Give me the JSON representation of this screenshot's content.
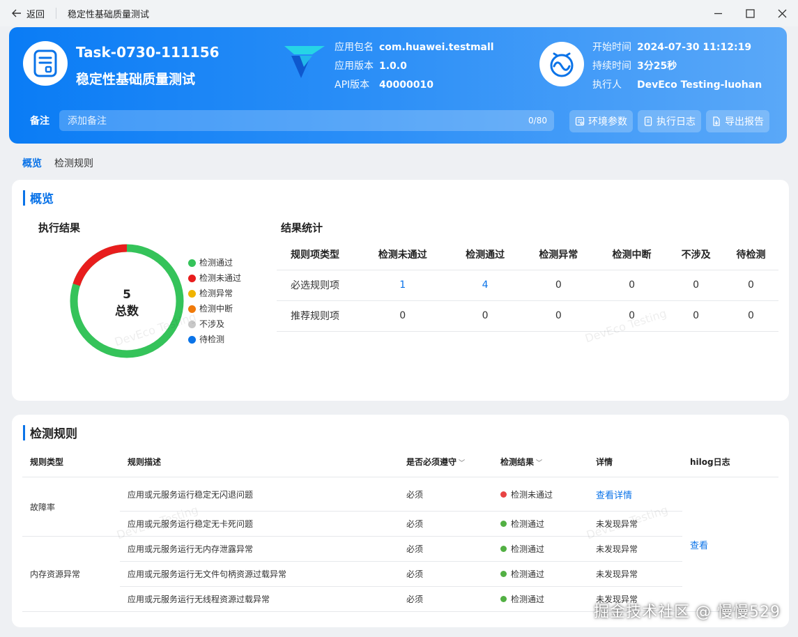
{
  "titlebar": {
    "back_label": "返回",
    "title": "稳定性基础质量测试"
  },
  "header": {
    "task_id": "Task-0730-111156",
    "task_name": "稳定性基础质量测试",
    "app_info": [
      {
        "key": "应用包名",
        "value": "com.huawei.testmall"
      },
      {
        "key": "应用版本",
        "value": "1.0.0"
      },
      {
        "key": "API版本",
        "value": "40000010"
      }
    ],
    "run_info": [
      {
        "key": "开始时间",
        "value": "2024-07-30 11:12:19"
      },
      {
        "key": "持续时间",
        "value": "3分25秒"
      },
      {
        "key": "执行人",
        "value": "DevEco Testing-luohan"
      }
    ],
    "note_label": "备注",
    "note_placeholder": "添加备注",
    "note_count": "0/80",
    "buttons": {
      "env": "环境参数",
      "log": "执行日志",
      "export": "导出报告"
    }
  },
  "tabs": [
    "概览",
    "检测规则"
  ],
  "overview": {
    "title": "概览",
    "result_title": "执行结果",
    "total_number": "5",
    "total_label": "总数",
    "legend": [
      {
        "label": "检测通过",
        "color": "#35c35a"
      },
      {
        "label": "检测未通过",
        "color": "#e81d1d"
      },
      {
        "label": "检测异常",
        "color": "#f0b400"
      },
      {
        "label": "检测中断",
        "color": "#f07a0a"
      },
      {
        "label": "不涉及",
        "color": "#c8c8c8"
      },
      {
        "label": "待检测",
        "color": "#0a73e8"
      }
    ],
    "donut": {
      "passed": 4,
      "failed": 1
    },
    "stats_title": "结果统计",
    "stats_headers": [
      "规则项类型",
      "检测未通过",
      "检测通过",
      "检测异常",
      "检测中断",
      "不涉及",
      "待检测"
    ],
    "stats_rows": [
      [
        "必选规则项",
        "1",
        "4",
        "0",
        "0",
        "0",
        "0"
      ],
      [
        "推荐规则项",
        "0",
        "0",
        "0",
        "0",
        "0",
        "0"
      ]
    ],
    "watermark": "DevEco Testing"
  },
  "rules": {
    "title": "检测规则",
    "headers": [
      "规则类型",
      "规则描述",
      "是否必须遵守",
      "检测结果",
      "详情",
      "hilog日志"
    ],
    "groups": [
      "故障率",
      "内存资源异常"
    ],
    "rows": [
      {
        "desc": "应用或元服务运行稳定无闪退问题",
        "required": "必须",
        "result": "检测未通过",
        "result_color": "#e84343",
        "detail": "查看详情"
      },
      {
        "desc": "应用或元服务运行稳定无卡死问题",
        "required": "必须",
        "result": "检测通过",
        "result_color": "#52b043",
        "detail": "未发现异常"
      },
      {
        "desc": "应用或元服务运行无内存泄露异常",
        "required": "必须",
        "result": "检测通过",
        "result_color": "#52b043",
        "detail": "未发现异常"
      },
      {
        "desc": "应用或元服务运行无文件句柄资源过载异常",
        "required": "必须",
        "result": "检测通过",
        "result_color": "#52b043",
        "detail": "未发现异常"
      },
      {
        "desc": "应用或元服务运行无线程资源过载异常",
        "required": "必须",
        "result": "检测通过",
        "result_color": "#52b043",
        "detail": "未发现异常"
      }
    ],
    "hilog_link": "查看"
  },
  "corner_watermark": "掘金技术社区 @ 慢慢529"
}
